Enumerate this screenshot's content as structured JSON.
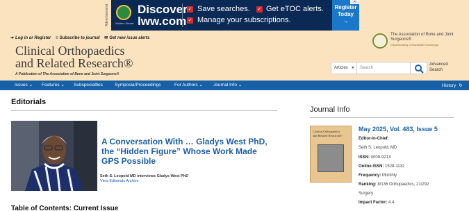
{
  "ad": {
    "side_label": "Advertisement",
    "logo_sub": "Wolters Kluwer",
    "discover": "Discover",
    "lww": "lww.com",
    "items": [
      "Save searches.",
      "Get eTOC alerts.",
      "Manage your subscriptions."
    ],
    "cta": "Register Today",
    "cta_arrow": "→",
    "close": "✕"
  },
  "header": {
    "links": [
      "Log in or Register",
      "Subscribe to journal",
      "Get new issue alerts"
    ],
    "brand_line1": "Clinical Orthopaedics",
    "brand_line2": "and Related Research®",
    "brand_sub": "A Publication of The Association of Bone and Joint Surgeons®",
    "aaos_name": "The Association of Bone and Joint Surgeons®",
    "aaos_tag": "Disseminating Orthopaedic Knowledge",
    "search_scope": "Articles",
    "search_placeholder": "Search",
    "advanced_search": "Advanced Search"
  },
  "nav": {
    "items": [
      "Issues",
      "Features",
      "Subspecialties",
      "Symposia/Proceedings",
      "For Authors",
      "Journal Info"
    ],
    "history": "History"
  },
  "main": {
    "section_title": "Editorials",
    "feature_title": "A Conversation With … Gladys West PhD, the “Hidden Figure” Whose Work Made GPS Possible",
    "feature_byline": "Seth S. Leopold MD interviews Gladys West PhD",
    "feature_archive": "View Editorials Archive",
    "toc_title": "Table of Contents: Current Issue"
  },
  "journal_info": {
    "title": "Journal Info",
    "issue": "May 2025, Vol. 483, Issue 5",
    "editor_label": "Editor-in-Chief:",
    "editor": "Seth S. Leopold, MD",
    "issn_label": "ISSN:",
    "issn": "0009-921X",
    "online_issn_label": "Online ISSN:",
    "online_issn": "1528-1132",
    "frequency_label": "Frequency:",
    "frequency": "Monthly",
    "ranking_label": "Ranking:",
    "ranking": "8/136 Orthopaedics, 21/292",
    "ranking_cont": "Surgery",
    "impact_label": "Impact Factor:",
    "impact": "4.4",
    "cover_title1": "Clinical Orthopaedics",
    "cover_title2": "and Related Research®"
  },
  "colors": {
    "header_bg": "#fbe3bf",
    "nav_bg": "#1560a6",
    "link_blue": "#1a5ea8",
    "ad_bg": "#0a2a55",
    "ad_check": "#d52b2b",
    "ad_cta": "#1b78c8"
  }
}
